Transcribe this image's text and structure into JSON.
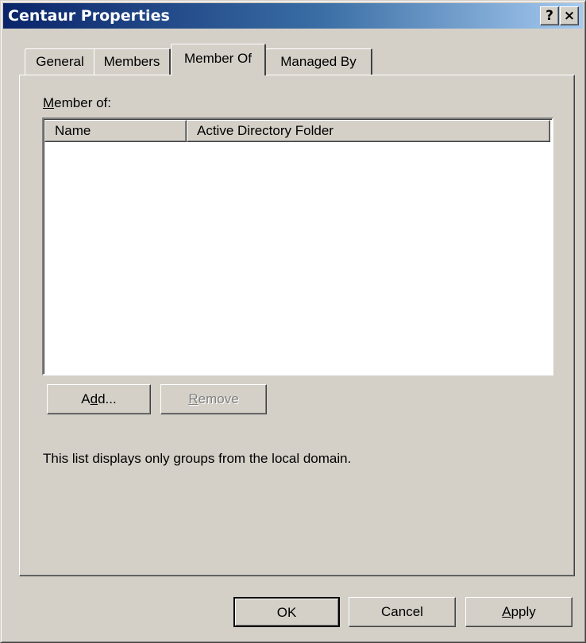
{
  "window": {
    "title": "Centaur Properties",
    "help_glyph": "?",
    "close_glyph": "×",
    "title_gradient": [
      "#0a246a",
      "#a6caf0"
    ],
    "face_color": "#d4d0c8"
  },
  "tabs": [
    {
      "label": "General",
      "selected": false
    },
    {
      "label": "Members",
      "selected": false
    },
    {
      "label": "Member Of",
      "selected": true
    },
    {
      "label": "Managed By",
      "selected": false
    }
  ],
  "panel": {
    "member_label_accel": "M",
    "member_label_rest": "ember of:",
    "list": {
      "columns": [
        "Name",
        "Active Directory Folder"
      ],
      "rows": []
    },
    "add_button": {
      "pre": "A",
      "accel": "d",
      "post": "d..."
    },
    "remove_button": {
      "accel": "R",
      "post": "emove",
      "enabled": false
    },
    "info_text": "This list displays only groups from the local domain."
  },
  "footer": {
    "ok": "OK",
    "cancel": "Cancel",
    "apply_accel": "A",
    "apply_rest": "pply"
  }
}
